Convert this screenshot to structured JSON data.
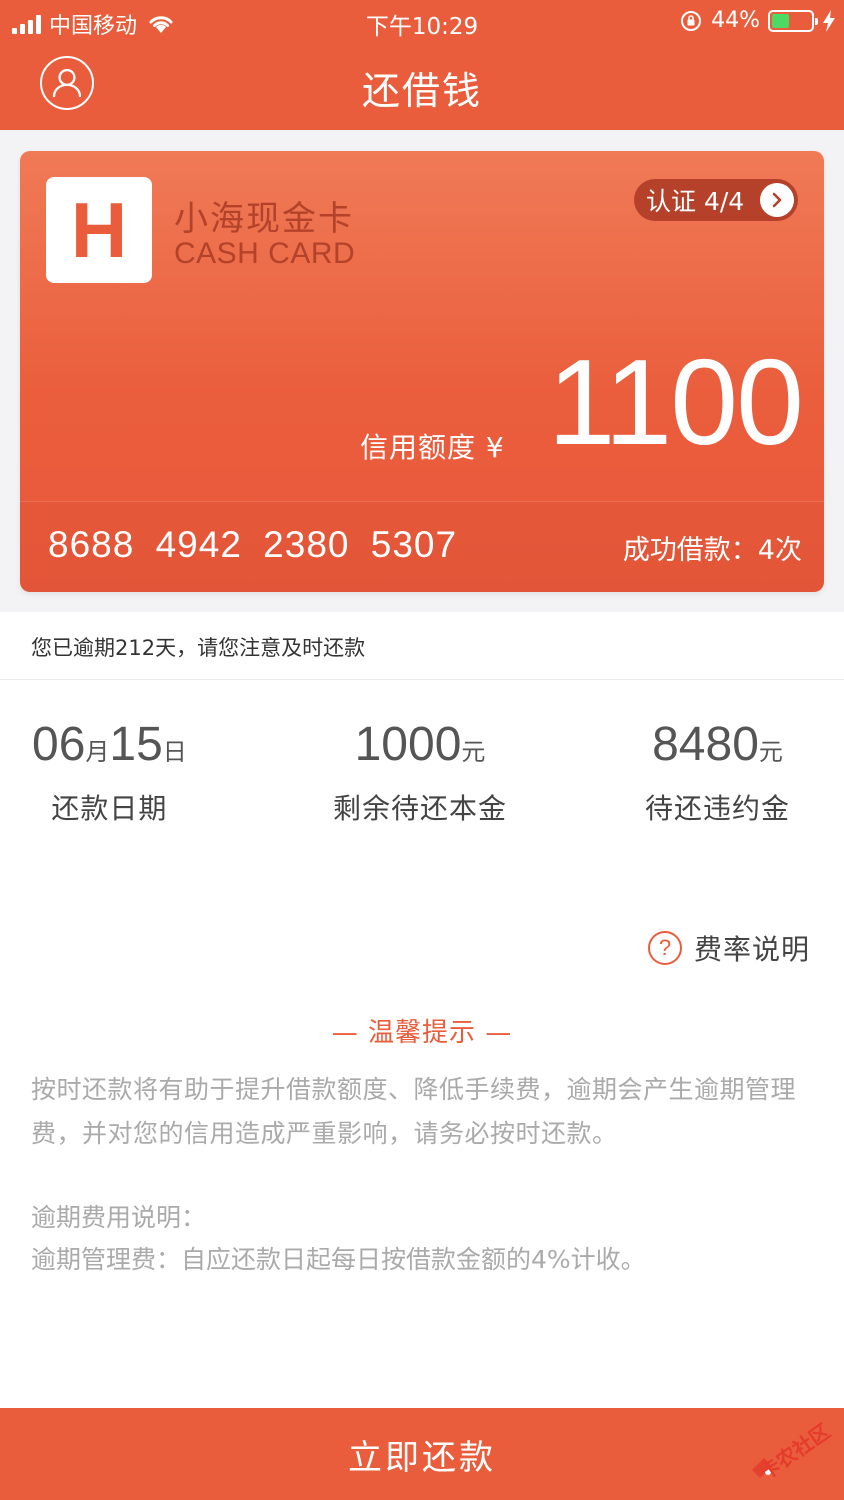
{
  "status_bar": {
    "carrier": "中国移动",
    "time": "下午10:29",
    "battery_percent": "44%",
    "battery_level": 0.44
  },
  "nav": {
    "title": "还借钱",
    "profile_icon": "user-icon"
  },
  "card": {
    "logo_letter": "H",
    "name": "小海现金卡",
    "name_en": "CASH CARD",
    "verify_label": "认证 4/4",
    "credit_label": "信用额度 ¥",
    "credit_amount": "1100",
    "card_number": "8688 4942 2380 5307",
    "loan_count": "成功借款：4次"
  },
  "notice": {
    "text": "您已逾期212天，请您注意及时还款"
  },
  "stats": {
    "date": {
      "month": "06",
      "month_unit": "月",
      "day": "15",
      "day_unit": "日",
      "label": "还款日期"
    },
    "principal": {
      "value": "1000",
      "unit": "元",
      "label": "剩余待还本金"
    },
    "penalty": {
      "value": "8480",
      "unit": "元",
      "label": "待还违约金"
    }
  },
  "rate_info": {
    "icon_text": "?",
    "label": "费率说明"
  },
  "tips": {
    "title": "— 温馨提示 —",
    "body": "按时还款将有助于提升借款额度、降低手续费，逾期会产生逾期管理费，并对您的信用造成严重影响，请务必按时还款。",
    "overdue_title": "逾期费用说明：",
    "overdue_desc": "逾期管理费：自应还款日起每日按借款金额的4%计收。"
  },
  "repay_button": {
    "label": "立即还款"
  },
  "watermark": {
    "text": "卡农社区"
  },
  "colors": {
    "brand": "#ea5d3c",
    "logo_text": "#b3422a",
    "battery": "#4cd964"
  }
}
